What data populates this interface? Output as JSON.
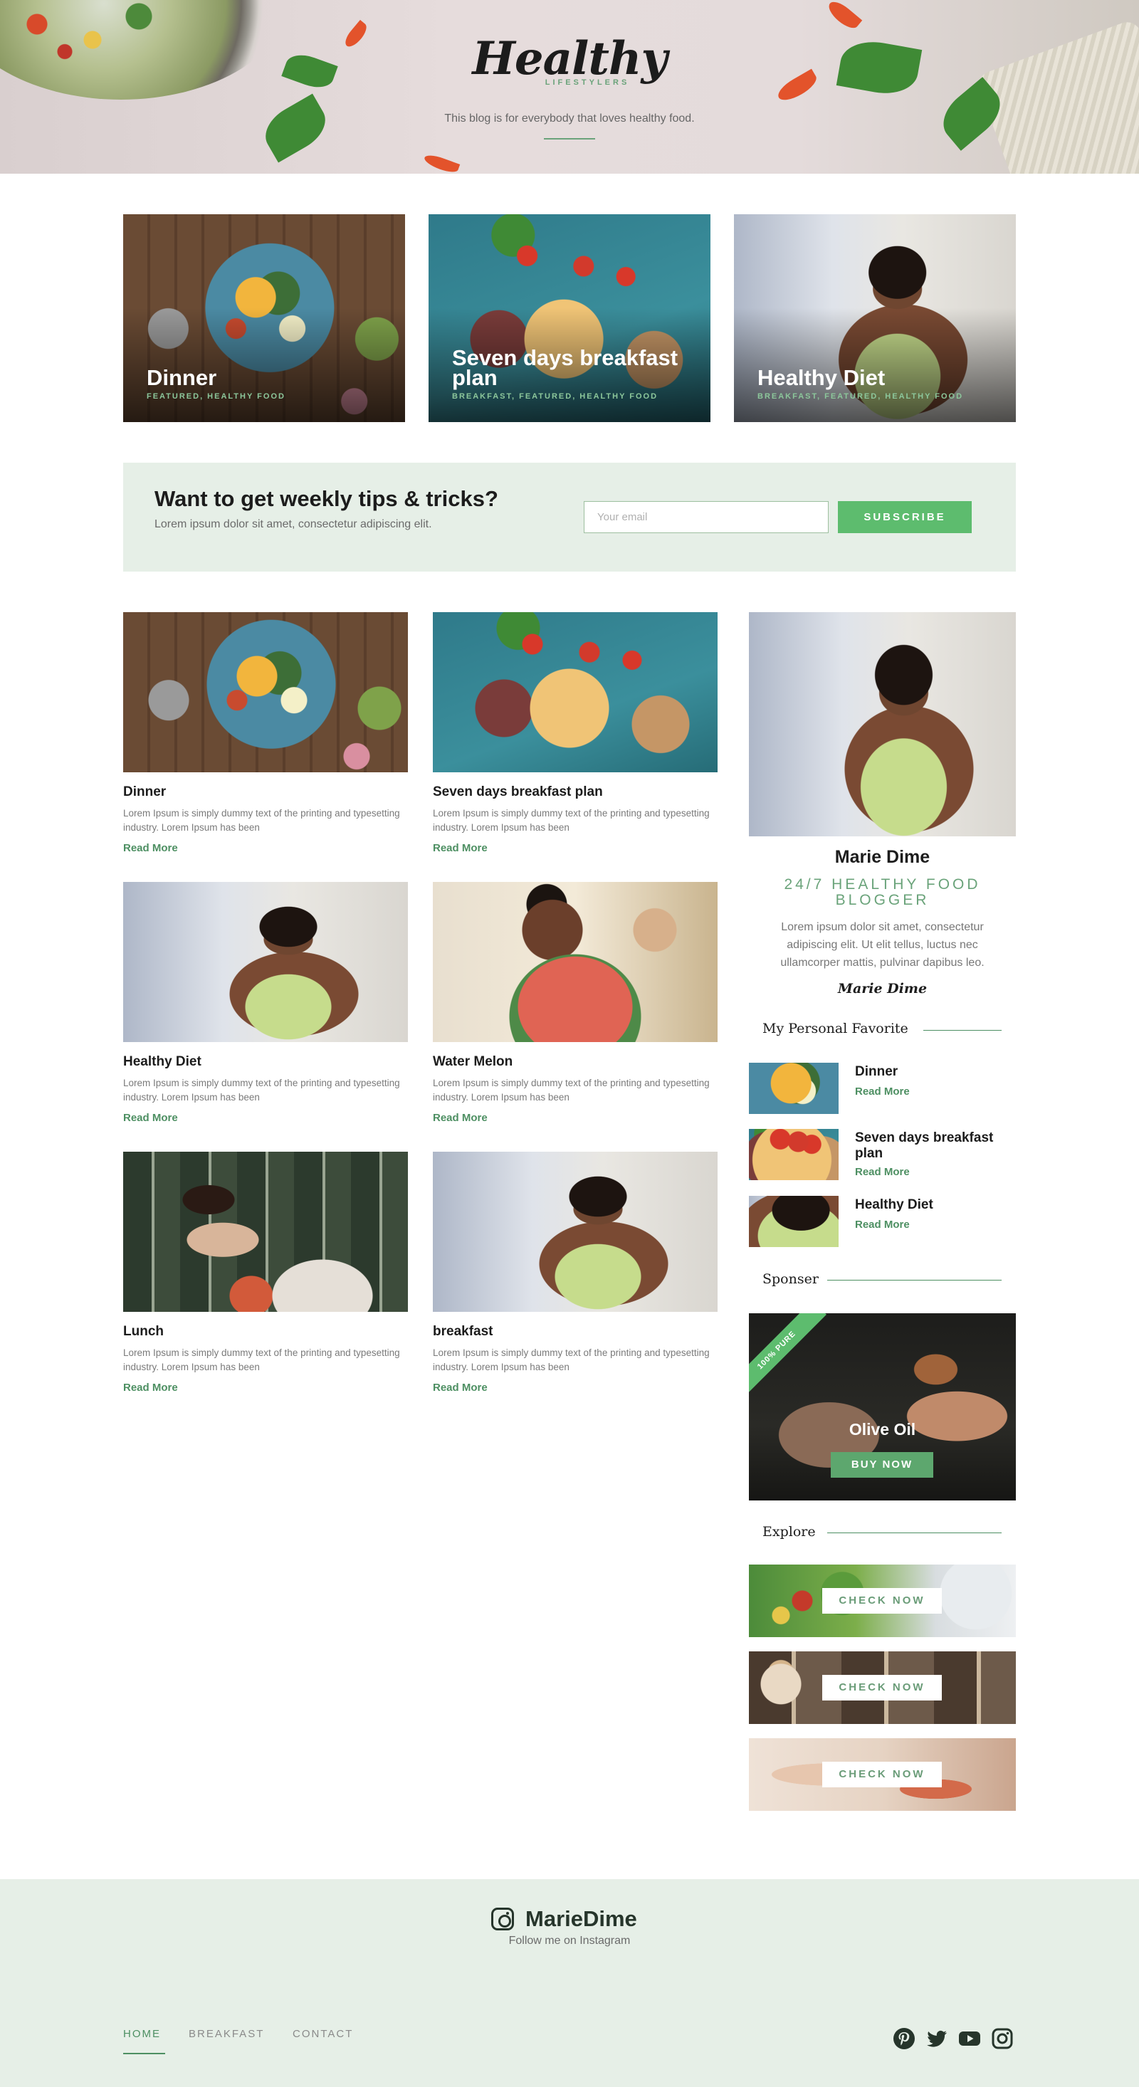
{
  "hero": {
    "logo": "Healthy",
    "logo_sub": "LIFESTYLERS",
    "tagline": "This blog is for everybody that loves healthy food."
  },
  "featured": [
    {
      "title": "Dinner",
      "tags": "FEATURED, HEALTHY FOOD"
    },
    {
      "title": "Seven days breakfast plan",
      "tags": "BREAKFAST, FEATURED, HEALTHY FOOD"
    },
    {
      "title": "Healthy Diet",
      "tags": "BREAKFAST, FEATURED, HEALTHY FOOD"
    }
  ],
  "newsletter": {
    "heading": "Want to get weekly tips & tricks?",
    "text": "Lorem ipsum dolor sit amet, consectetur adipiscing elit.",
    "email_placeholder": "Your email",
    "button": "SUBSCRIBE"
  },
  "posts": [
    {
      "title": "Dinner",
      "excerpt": "Lorem Ipsum is simply dummy text of the printing and typesetting industry. Lorem Ipsum has been",
      "more": "Read More"
    },
    {
      "title": "Seven days breakfast plan",
      "excerpt": "Lorem Ipsum is simply dummy text of the printing and typesetting industry. Lorem Ipsum has been",
      "more": "Read More"
    },
    {
      "title": "Healthy Diet",
      "excerpt": "Lorem Ipsum is simply dummy text of the printing and typesetting industry. Lorem Ipsum has been",
      "more": "Read More"
    },
    {
      "title": "Water Melon",
      "excerpt": "Lorem Ipsum is simply dummy text of the printing and typesetting industry. Lorem Ipsum has been",
      "more": "Read More"
    },
    {
      "title": "Lunch",
      "excerpt": "Lorem Ipsum is simply dummy text of the printing and typesetting industry. Lorem Ipsum has been",
      "more": "Read More"
    },
    {
      "title": "breakfast",
      "excerpt": "Lorem Ipsum is simply dummy text of the printing and typesetting industry. Lorem Ipsum has been",
      "more": "Read More"
    }
  ],
  "author": {
    "name": "Marie Dime",
    "role": "24/7 HEALTHY FOOD BLOGGER",
    "bio": "Lorem ipsum dolor sit amet, consectetur adipiscing elit. Ut elit tellus, luctus nec ullamcorper mattis, pulvinar dapibus leo.",
    "signature": "Marie Dime"
  },
  "favorites": {
    "heading": "My Personal Favorite",
    "items": [
      {
        "title": "Dinner",
        "more": "Read More"
      },
      {
        "title": "Seven days breakfast plan",
        "more": "Read More"
      },
      {
        "title": "Healthy Diet",
        "more": "Read More"
      }
    ]
  },
  "sponsor": {
    "heading": "Sponser",
    "ribbon": "100% PURE",
    "name": "Olive Oil",
    "button": "BUY NOW"
  },
  "explore": {
    "heading": "Explore",
    "buttons": [
      "CHECK NOW",
      "CHECK NOW",
      "CHECK NOW"
    ]
  },
  "footer": {
    "instagram_handle": "MarieDime",
    "follow_text": "Follow me on Instagram",
    "nav": [
      "HOME",
      "BREAKFAST",
      "CONTACT"
    ],
    "social_icons": [
      "pinterest-icon",
      "twitter-icon",
      "youtube-icon",
      "instagram-icon"
    ]
  },
  "colors": {
    "accent_green": "#5dbc6e",
    "text_green": "#4d8f62",
    "light_green_bg": "#e6efe7",
    "dark_text": "#1c1c1c"
  }
}
